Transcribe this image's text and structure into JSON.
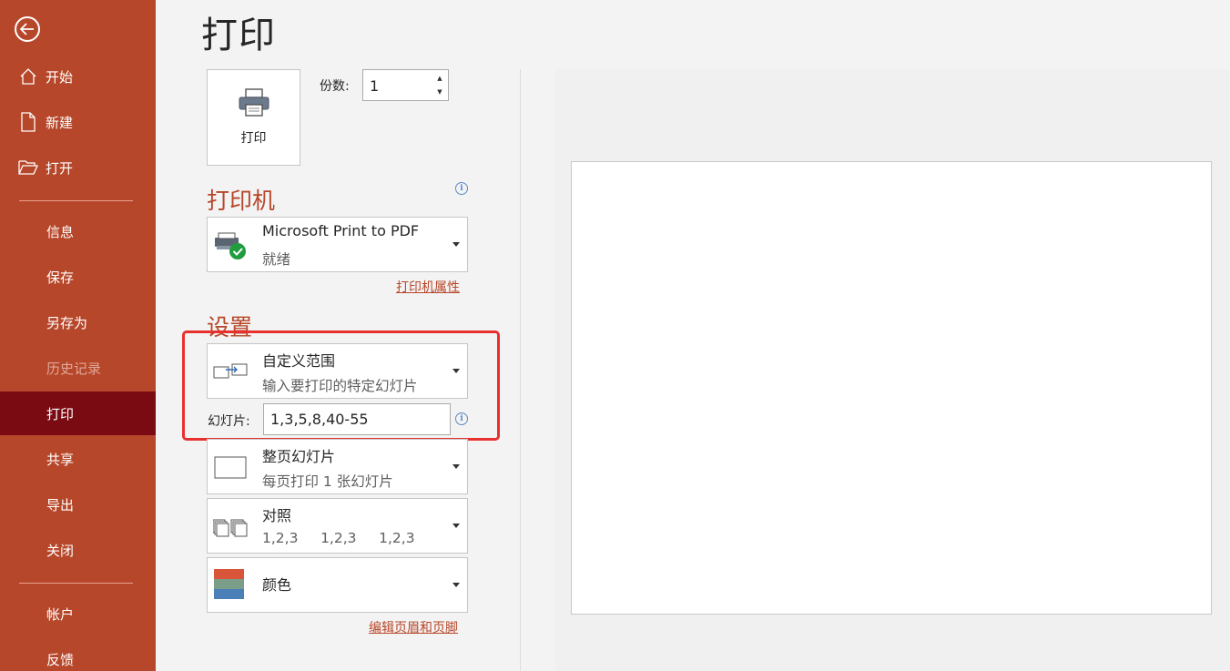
{
  "sidebar": {
    "items": [
      {
        "label": "开始",
        "icon": "home-icon"
      },
      {
        "label": "新建",
        "icon": "new-file-icon"
      },
      {
        "label": "打开",
        "icon": "open-folder-icon"
      },
      {
        "label": "信息"
      },
      {
        "label": "保存"
      },
      {
        "label": "另存为"
      },
      {
        "label": "历史记录",
        "state": "disabled"
      },
      {
        "label": "打印",
        "state": "active"
      },
      {
        "label": "共享"
      },
      {
        "label": "导出"
      },
      {
        "label": "关闭"
      },
      {
        "label": "帐户"
      },
      {
        "label": "反馈"
      }
    ]
  },
  "page": {
    "title": "打印"
  },
  "print_button": {
    "label": "打印"
  },
  "copies": {
    "label": "份数:",
    "value": "1"
  },
  "printer": {
    "section_title": "打印机",
    "name": "Microsoft Print to PDF",
    "status": "就绪",
    "properties_link": "打印机属性"
  },
  "settings": {
    "section_title": "设置",
    "range": {
      "main": "自定义范围",
      "sub": "输入要打印的特定幻灯片"
    },
    "slides_label": "幻灯片:",
    "slides_value": "1,3,5,8,40-55",
    "layout": {
      "main": "整页幻灯片",
      "sub": "每页打印 1 张幻灯片"
    },
    "collate": {
      "main": "对照",
      "sub": "1,2,3     1,2,3     1,2,3"
    },
    "color": {
      "main": "颜色"
    },
    "header_footer_link": "编辑页眉和页脚"
  },
  "colors": {
    "accent": "#b7472a",
    "active_nav": "#7a0b13",
    "highlight": "#e8302f"
  }
}
